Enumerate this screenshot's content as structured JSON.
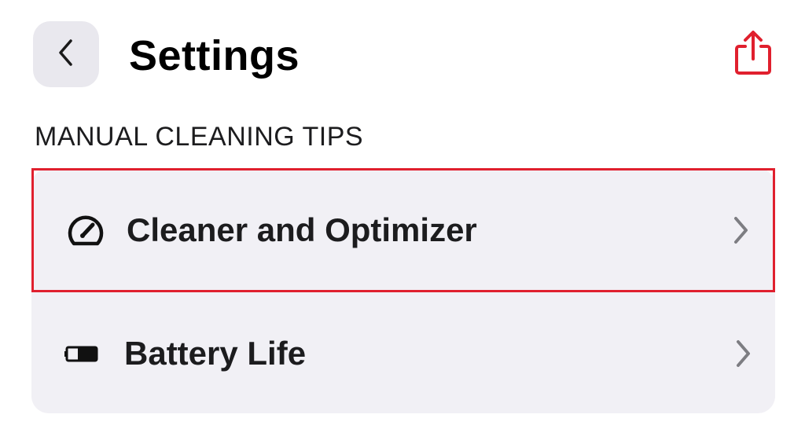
{
  "header": {
    "title": "Settings",
    "back_icon": "chevron-left-icon",
    "share_icon": "share-icon"
  },
  "section": {
    "title": "MANUAL CLEANING TIPS"
  },
  "items": [
    {
      "label": "Cleaner and Optimizer",
      "icon": "speedometer-icon",
      "highlighted": true
    },
    {
      "label": "Battery Life",
      "icon": "battery-icon",
      "highlighted": false
    }
  ],
  "colors": {
    "accent": "#e0202e",
    "group_background": "#f1f0f5",
    "back_button_background": "#e9e8ee"
  }
}
